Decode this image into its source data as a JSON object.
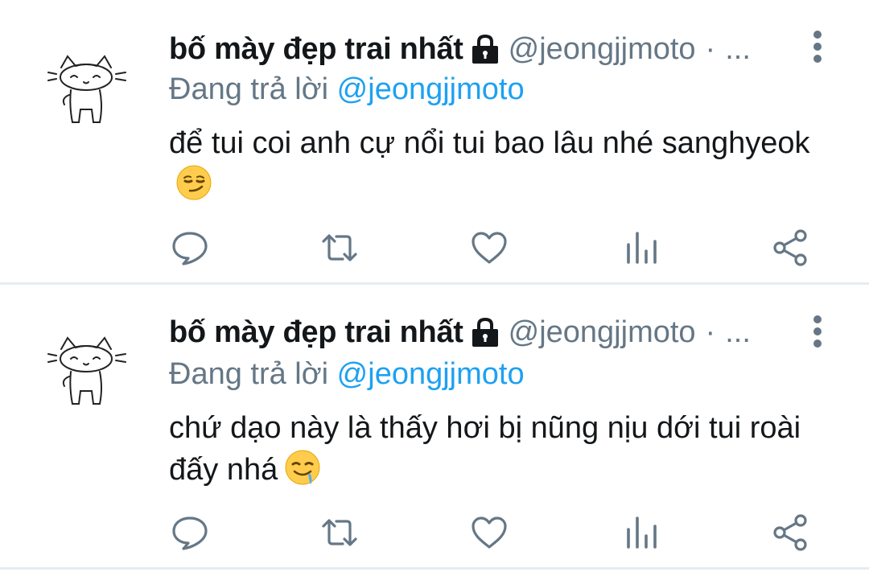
{
  "tweets": [
    {
      "display_name": "bố mày đẹp trai nhất",
      "handle": "@jeongjjmoto",
      "separator": "·",
      "truncation": "...",
      "replying_prefix": "Đang trả lời",
      "replying_to": "@jeongjjmoto",
      "text": "để tui coi anh cự nổi tui bao lâu nhé sanghyeok",
      "emoji": "smirking-face",
      "locked": true
    },
    {
      "display_name": "bố mày đẹp trai nhất",
      "handle": "@jeongjjmoto",
      "separator": "·",
      "truncation": "...",
      "replying_prefix": "Đang trả lời",
      "replying_to": "@jeongjjmoto",
      "text": "chứ dạo này là thấy hơi bị nũng nịu dới tui roài đấy nhá",
      "emoji": "drooling-face",
      "locked": true
    }
  ],
  "actions": [
    "reply-icon",
    "retweet-icon",
    "like-icon",
    "analytics-icon",
    "share-icon"
  ],
  "colors": {
    "text": "#14171a",
    "secondary": "#657786",
    "mention": "#1da1f2",
    "divider": "#e6ecf0"
  }
}
